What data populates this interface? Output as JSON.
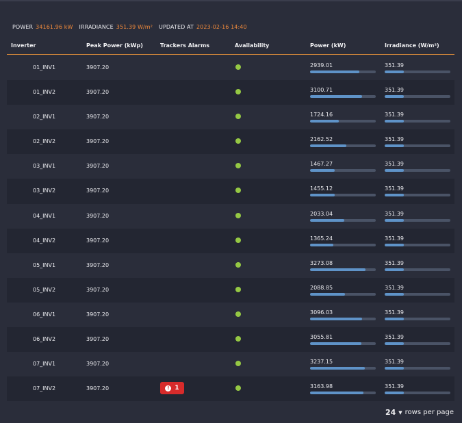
{
  "summary": {
    "power_label": "POWER",
    "power_value": "34161.96 kW",
    "irradiance_label": "IRRADIANCE",
    "irradiance_value": "351.39 W/m²",
    "updated_label": "UPDATED AT",
    "updated_value": "2023-02-16 14:40"
  },
  "columns": {
    "inverter": "Inverter",
    "peak_power": "Peak Power (kWp)",
    "trackers_alarms": "Trackers Alarms",
    "availability": "Availability",
    "power": "Power (kW)",
    "irradiance": "Irradiance (W/m²)"
  },
  "colors": {
    "orange": "#f08a3c",
    "available": "#95c844",
    "bar": "#5f93c8",
    "alarm": "#d72b2b"
  },
  "rows": [
    {
      "inverter": "01_INV1",
      "peak": "3907.20",
      "alarm": "",
      "power": "2939.01",
      "power_frac": 0.75,
      "irr": "351.39",
      "irr_frac": 0.29
    },
    {
      "inverter": "01_INV2",
      "peak": "3907.20",
      "alarm": "",
      "power": "3100.71",
      "power_frac": 0.79,
      "irr": "351.39",
      "irr_frac": 0.29
    },
    {
      "inverter": "02_INV1",
      "peak": "3907.20",
      "alarm": "",
      "power": "1724.16",
      "power_frac": 0.44,
      "irr": "351.39",
      "irr_frac": 0.29
    },
    {
      "inverter": "02_INV2",
      "peak": "3907.20",
      "alarm": "",
      "power": "2162.52",
      "power_frac": 0.55,
      "irr": "351.39",
      "irr_frac": 0.29
    },
    {
      "inverter": "03_INV1",
      "peak": "3907.20",
      "alarm": "",
      "power": "1467.27",
      "power_frac": 0.38,
      "irr": "351.39",
      "irr_frac": 0.29
    },
    {
      "inverter": "03_INV2",
      "peak": "3907.20",
      "alarm": "",
      "power": "1455.12",
      "power_frac": 0.37,
      "irr": "351.39",
      "irr_frac": 0.29
    },
    {
      "inverter": "04_INV1",
      "peak": "3907.20",
      "alarm": "",
      "power": "2033.04",
      "power_frac": 0.52,
      "irr": "351.39",
      "irr_frac": 0.29
    },
    {
      "inverter": "04_INV2",
      "peak": "3907.20",
      "alarm": "",
      "power": "1365.24",
      "power_frac": 0.35,
      "irr": "351.39",
      "irr_frac": 0.29
    },
    {
      "inverter": "05_INV1",
      "peak": "3907.20",
      "alarm": "",
      "power": "3273.08",
      "power_frac": 0.84,
      "irr": "351.39",
      "irr_frac": 0.29
    },
    {
      "inverter": "05_INV2",
      "peak": "3907.20",
      "alarm": "",
      "power": "2088.85",
      "power_frac": 0.53,
      "irr": "351.39",
      "irr_frac": 0.29
    },
    {
      "inverter": "06_INV1",
      "peak": "3907.20",
      "alarm": "",
      "power": "3096.03",
      "power_frac": 0.79,
      "irr": "351.39",
      "irr_frac": 0.29
    },
    {
      "inverter": "06_INV2",
      "peak": "3907.20",
      "alarm": "",
      "power": "3055.81",
      "power_frac": 0.78,
      "irr": "351.39",
      "irr_frac": 0.29
    },
    {
      "inverter": "07_INV1",
      "peak": "3907.20",
      "alarm": "",
      "power": "3237.15",
      "power_frac": 0.83,
      "irr": "351.39",
      "irr_frac": 0.29
    },
    {
      "inverter": "07_INV2",
      "peak": "3907.20",
      "alarm": "1",
      "power": "3163.98",
      "power_frac": 0.81,
      "irr": "351.39",
      "irr_frac": 0.29
    }
  ],
  "pagination": {
    "rows_per_page": "24",
    "label": "rows per page"
  }
}
